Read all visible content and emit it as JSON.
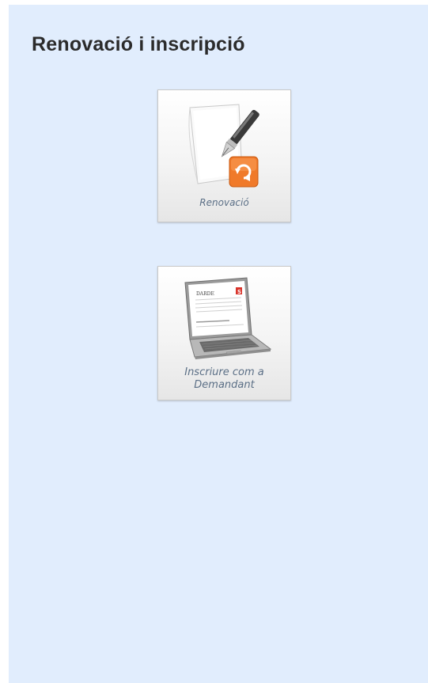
{
  "header": {
    "title": "Renovació i inscripció"
  },
  "tiles": [
    {
      "label": "Renovació",
      "icon": "document-pen-refresh-icon",
      "badge_color": "#f07a2a"
    },
    {
      "label_line1": "Inscriure com a",
      "label_line2": "Demandant",
      "icon": "laptop-form-icon",
      "screen_text": "DARDE",
      "badge_color": "#d9342b"
    }
  ],
  "colors": {
    "background": "#e1edfd",
    "title": "#2b2b2b",
    "tile_label": "#5b6f86"
  }
}
